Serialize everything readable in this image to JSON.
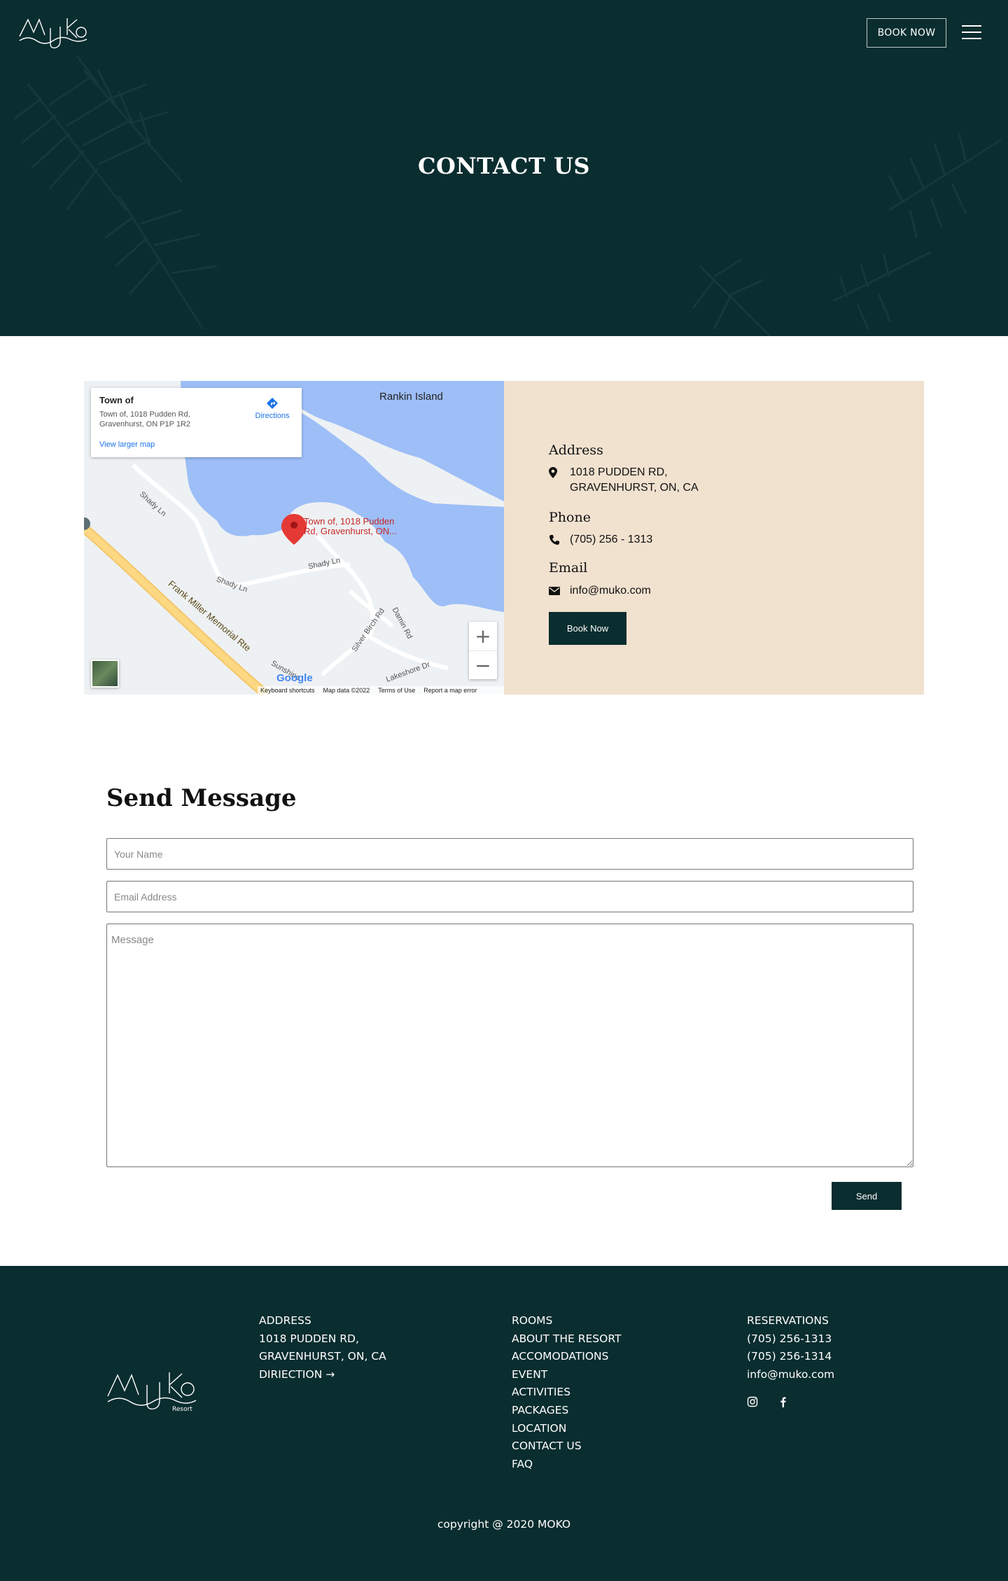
{
  "header": {
    "book_now": "BOOK NOW",
    "logo_icon": "muko-logo",
    "menu_icon": "hamburger-menu-icon",
    "title": "CONTACT US"
  },
  "map": {
    "card_title": "Town of",
    "card_address": "Town of, 1018 Pudden Rd, Gravenhurst, ON P1P 1R2",
    "directions": "Directions",
    "view_larger": "View larger map",
    "place_label_1": "Town of, 1018 Pudden",
    "place_label_2": "Rd, Gravenhurst, ON...",
    "island": "Rankin Island",
    "roads": {
      "shady1": "Shady Ln",
      "shady2": "Shady Ln",
      "shady3": "Shady Ln",
      "frank": "Frank Miller Memorial Rte",
      "silver": "Silver Birch Rd",
      "damin": "Damin Rd",
      "lakeshore": "Lakeshore Dr",
      "sunshine": "Sunshine"
    },
    "zoom_in": "+",
    "zoom_out": "−",
    "google": "Google",
    "footer": {
      "shortcuts": "Keyboard shortcuts",
      "data": "Map data ©2022",
      "terms": "Terms of Use",
      "report": "Report a map error"
    }
  },
  "contact": {
    "address_heading": "Address",
    "address_line1": "1018 PUDDEN RD,",
    "address_line2": "GRAVENHURST, ON, CA",
    "phone_heading": "Phone",
    "phone": "(705) 256 - 1313",
    "email_heading": "Email",
    "email": "info@muko.com",
    "book_now": "Book Now"
  },
  "form": {
    "title": "Send Message",
    "name_placeholder": "Your Name",
    "email_placeholder": "Email Address",
    "message_placeholder": "Message",
    "send": "Send"
  },
  "footer": {
    "resort_word": "Resort",
    "col1": [
      "ADDRESS",
      "1018 PUDDEN RD,",
      "GRAVENHURST, ON, CA",
      "DIRIECTION →"
    ],
    "col2": [
      "ROOMS",
      "ABOUT THE RESORT",
      "ACCOMODATIONS",
      "EVENT",
      "ACTIVITIES",
      "PACKAGES",
      "LOCATION",
      "CONTACT US",
      "FAQ"
    ],
    "col3": [
      "RESERVATIONS",
      "(705) 256-1313",
      "(705) 256-1314",
      "info@muko.com"
    ],
    "social": [
      "instagram-icon",
      "facebook-icon"
    ],
    "copyright": "copyright @ 2020 MOKO"
  },
  "colors": {
    "brand_dark": "#0a2d2f",
    "panel_beige": "#f1e1cf",
    "map_water": "#9dbef7",
    "map_land": "#eef1f3",
    "map_road": "#fbd881",
    "pin": "#e53935"
  }
}
